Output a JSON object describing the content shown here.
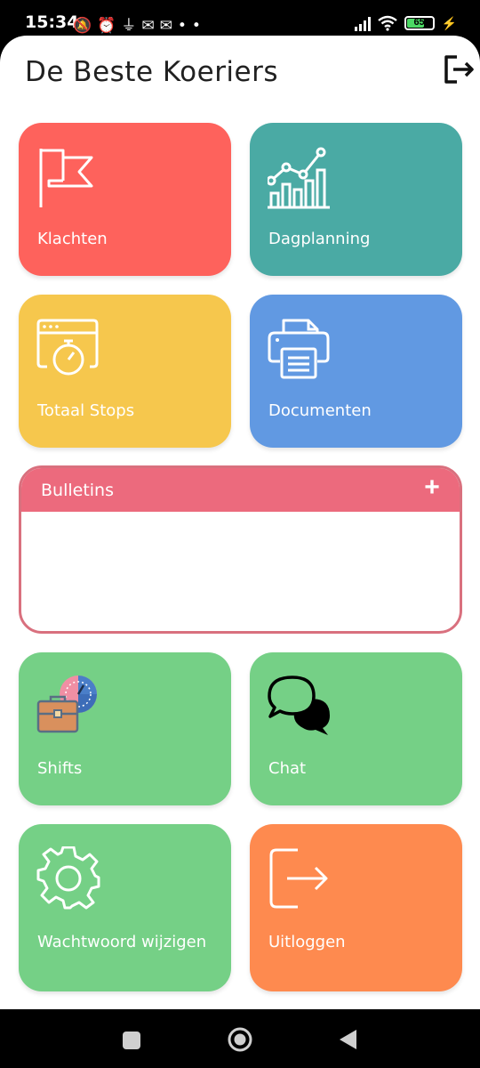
{
  "status_bar": {
    "time": "15:34",
    "notification_icons": [
      "muted-icon",
      "alarm-icon",
      "usb-icon",
      "mail-icon",
      "mail-icon"
    ],
    "more": "••",
    "battery_level": "65"
  },
  "header": {
    "title": "De Beste Koeriers"
  },
  "tiles": {
    "klachten": {
      "label": "Klachten",
      "color": "#fe625c",
      "icon": "flag-icon"
    },
    "dagplanning": {
      "label": "Dagplanning",
      "color": "#4aaaa4",
      "icon": "bar-chart-icon"
    },
    "totaal_stops": {
      "label": "Totaal Stops",
      "color": "#f6c74d",
      "icon": "stopwatch-icon"
    },
    "documenten": {
      "label": "Documenten",
      "color": "#6199e2",
      "icon": "printer-icon"
    },
    "shifts": {
      "label": "Shifts",
      "color": "#75d086",
      "icon": "briefcase-clock-icon"
    },
    "chat": {
      "label": "Chat",
      "color": "#75d086",
      "icon": "chat-bubbles-icon"
    },
    "wachtwoord": {
      "label": "Wachtwoord wijzigen",
      "color": "#75d086",
      "icon": "gear-icon"
    },
    "uitloggen": {
      "label": "Uitloggen",
      "color": "#fe8a4f",
      "icon": "logout-icon"
    }
  },
  "bulletins": {
    "title": "Bulletins",
    "add_symbol": "+",
    "items": []
  },
  "nav_bar": {
    "buttons": [
      "recents",
      "home",
      "back"
    ]
  }
}
